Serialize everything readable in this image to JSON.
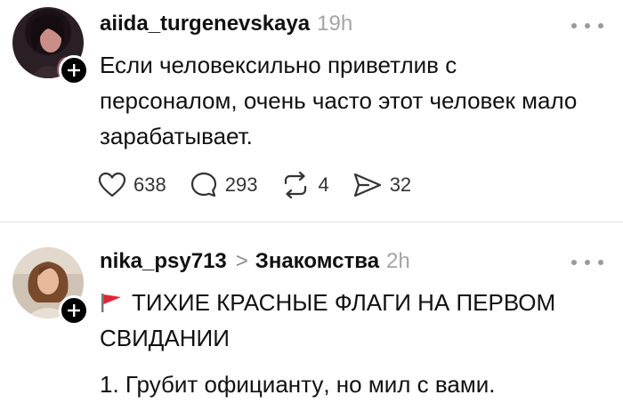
{
  "posts": [
    {
      "username": "aiida_turgenevskaya",
      "time": "19h",
      "text_plain_1": "Если человек",
      "text_hl_1": "сильно приветлив с",
      "text_hl_2": "персоналом",
      "text_plain_2": ", очень часто этот человек мало зарабатывает.",
      "actions": {
        "likes": "638",
        "comments": "293",
        "reposts": "4",
        "shares": "32"
      }
    },
    {
      "username": "nika_psy713",
      "chevron": ">",
      "community": "Знакомства",
      "time": "2h",
      "title": "ТИХИЕ КРАСНЫЕ ФЛАГИ НА ПЕРВОМ СВИДАНИИ",
      "item_hl": "1. Грубит официанту",
      "item_plain": ", но мил с вами."
    }
  ],
  "colors": {
    "highlight": "#ec586e",
    "muted": "#a5a5a5",
    "flag": "#e0243a"
  },
  "icons": {
    "like": "heart-icon",
    "comment": "comment-icon",
    "repost": "repost-icon",
    "share": "share-icon",
    "more": "more-icon",
    "follow": "plus-icon",
    "flag": "red-flag-icon"
  }
}
